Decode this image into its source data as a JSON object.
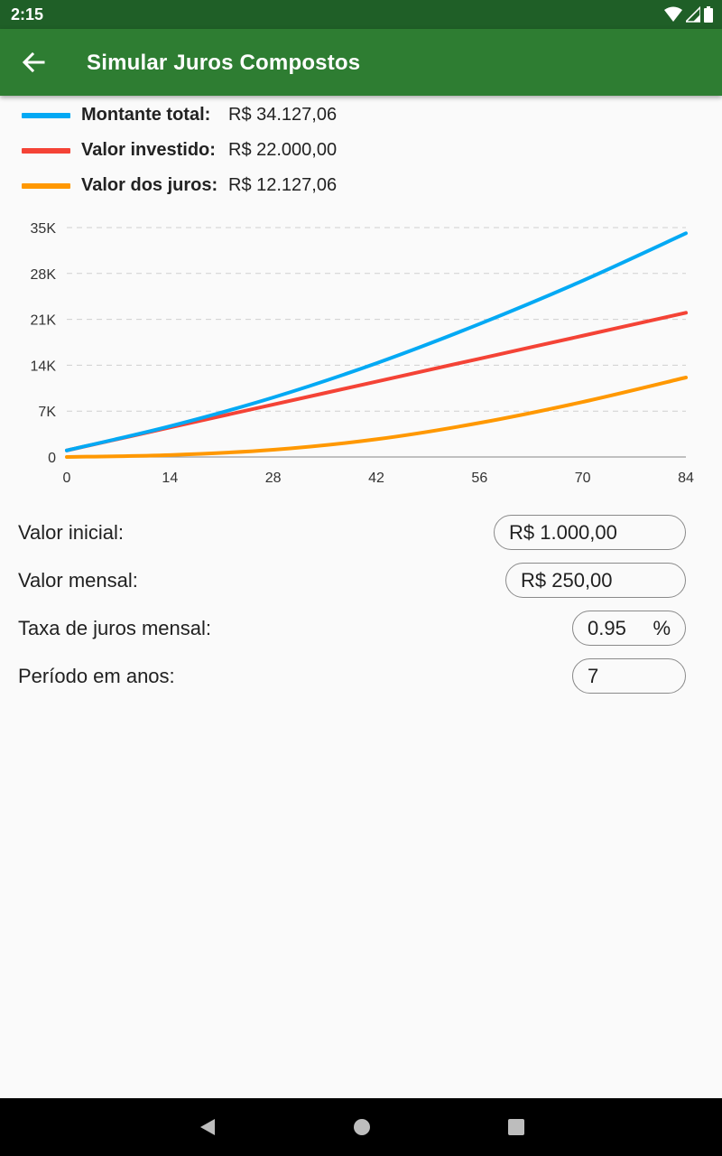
{
  "status_bar": {
    "time": "2:15"
  },
  "app_bar": {
    "title": "Simular Juros Compostos"
  },
  "legend": [
    {
      "label": "Montante total:",
      "value": "R$ 34.127,06",
      "color": "#03a9f4"
    },
    {
      "label": "Valor investido:",
      "value": "R$ 22.000,00",
      "color": "#f44336"
    },
    {
      "label": "Valor dos juros:",
      "value": "R$ 12.127,06",
      "color": "#ff9800"
    }
  ],
  "chart_data": {
    "type": "line",
    "x_ticks": [
      0,
      14,
      28,
      42,
      56,
      70,
      84
    ],
    "y_ticks": [
      0,
      7000,
      14000,
      21000,
      28000,
      35000
    ],
    "y_tick_labels": [
      "0",
      "7K",
      "14K",
      "21K",
      "28K",
      "35K"
    ],
    "xlim": [
      0,
      84
    ],
    "ylim": [
      0,
      35000
    ],
    "grid": "horizontal-dashed",
    "series": [
      {
        "name": "Montante total",
        "color": "#03a9f4",
        "x": [
          0,
          14,
          28,
          42,
          56,
          70,
          84
        ],
        "values": [
          1000,
          4700,
          9080,
          14300,
          20300,
          26900,
          34127
        ]
      },
      {
        "name": "Valor investido",
        "color": "#f44336",
        "x": [
          0,
          14,
          28,
          42,
          56,
          70,
          84
        ],
        "values": [
          1000,
          4500,
          8000,
          11500,
          15000,
          18500,
          22000
        ]
      },
      {
        "name": "Valor dos juros",
        "color": "#ff9800",
        "x": [
          0,
          14,
          28,
          42,
          56,
          70,
          84
        ],
        "values": [
          0,
          300,
          1100,
          2700,
          5200,
          8400,
          12127
        ]
      }
    ]
  },
  "form": {
    "initial_label": "Valor inicial:",
    "initial_value": "R$ 1.000,00",
    "monthly_label": "Valor mensal:",
    "monthly_value": "R$ 250,00",
    "rate_label": "Taxa de juros mensal:",
    "rate_value": "0.95",
    "rate_suffix": "%",
    "period_label": "Período em anos:",
    "period_value": "7"
  },
  "icons": {
    "back": "arrow-back-icon",
    "wifi": "wifi-icon",
    "signal": "signal-icon",
    "battery": "battery-icon"
  }
}
